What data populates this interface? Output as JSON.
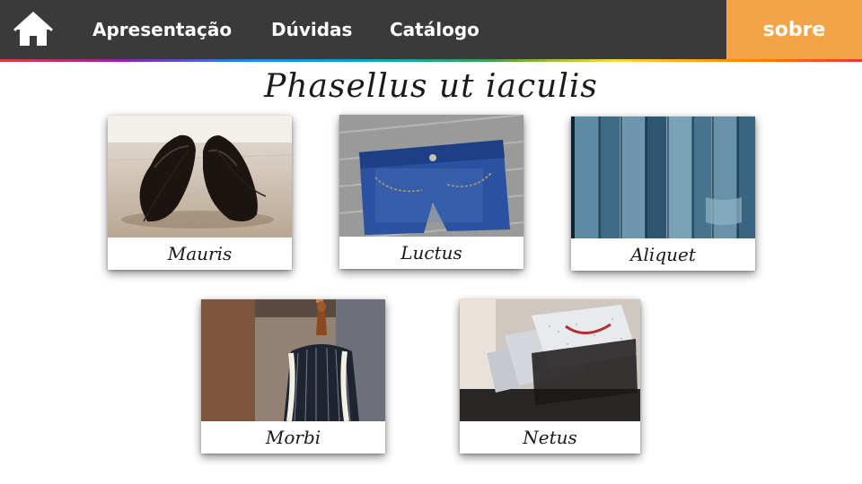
{
  "nav": {
    "home_icon": "home-icon",
    "items": [
      {
        "label": "Apresentação"
      },
      {
        "label": "Dúvidas"
      },
      {
        "label": "Catálogo"
      }
    ],
    "sobre_label": "sobre",
    "colors": {
      "bar": "#3a3a3a",
      "accent": "#f2a446",
      "text": "#ffffff"
    }
  },
  "main": {
    "title": "Phasellus ut iaculis",
    "cards": [
      {
        "label": "Mauris",
        "image": "black-leather-shoes"
      },
      {
        "label": "Luctus",
        "image": "denim-shorts"
      },
      {
        "label": "Aliquet",
        "image": "hanging-jeans"
      },
      {
        "label": "Morbi",
        "image": "tailor-mannequin"
      },
      {
        "label": "Netus",
        "image": "folded-dress-shirts"
      }
    ]
  }
}
